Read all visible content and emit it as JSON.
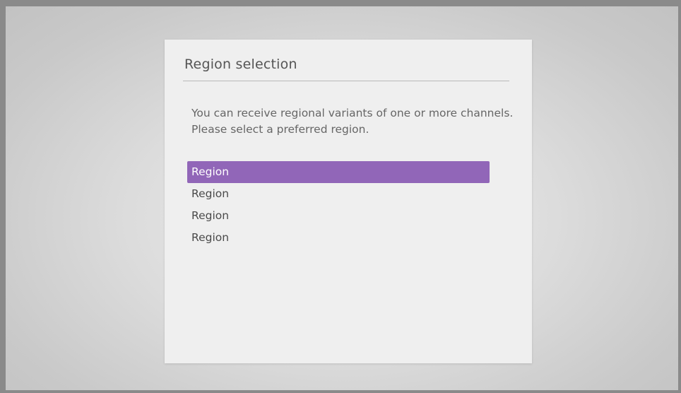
{
  "dialog": {
    "title": "Region selection",
    "message": "You can receive regional variants of one or more channels. Please select a preferred region.",
    "selected_index": 0,
    "options": [
      {
        "label": "Region"
      },
      {
        "label": "Region"
      },
      {
        "label": "Region"
      },
      {
        "label": "Region"
      }
    ]
  },
  "colors": {
    "accent": "#9166b8",
    "dialog_bg": "#efefef",
    "frame": "#8a8a8a"
  }
}
